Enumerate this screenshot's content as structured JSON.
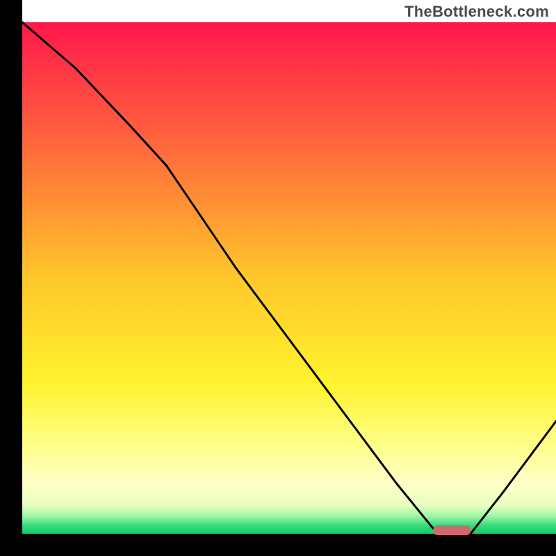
{
  "watermark": "TheBottleneck.com",
  "chart_data": {
    "type": "line",
    "title": "",
    "xlabel": "",
    "ylabel": "",
    "xlim": [
      0,
      100
    ],
    "ylim": [
      0,
      100
    ],
    "grid": false,
    "legend": false,
    "series": [
      {
        "name": "curve",
        "x": [
          0,
          10,
          20,
          27,
          40,
          55,
          70,
          77,
          80,
          84,
          90,
          100
        ],
        "y": [
          100,
          91,
          80,
          72,
          52,
          31,
          10,
          1,
          0,
          0,
          8,
          22
        ]
      }
    ],
    "marker": {
      "name": "highlight-bar",
      "x_start": 77,
      "x_end": 84,
      "y": 0,
      "color": "#CE6A6B"
    },
    "background_gradient": {
      "stops": [
        {
          "offset": 0.0,
          "color": "#FF174B"
        },
        {
          "offset": 0.25,
          "color": "#FF6B3B"
        },
        {
          "offset": 0.5,
          "color": "#FFC72B"
        },
        {
          "offset": 0.7,
          "color": "#FFF22B"
        },
        {
          "offset": 0.83,
          "color": "#FFFF8B"
        },
        {
          "offset": 0.9,
          "color": "#FFFFC8"
        },
        {
          "offset": 0.945,
          "color": "#E6FFBF"
        },
        {
          "offset": 0.965,
          "color": "#9FF7A5"
        },
        {
          "offset": 0.985,
          "color": "#2EDC7B"
        },
        {
          "offset": 1.0,
          "color": "#17C96B"
        }
      ]
    },
    "axes_color": "#000000",
    "line_color": "#000000",
    "line_width": 3
  }
}
